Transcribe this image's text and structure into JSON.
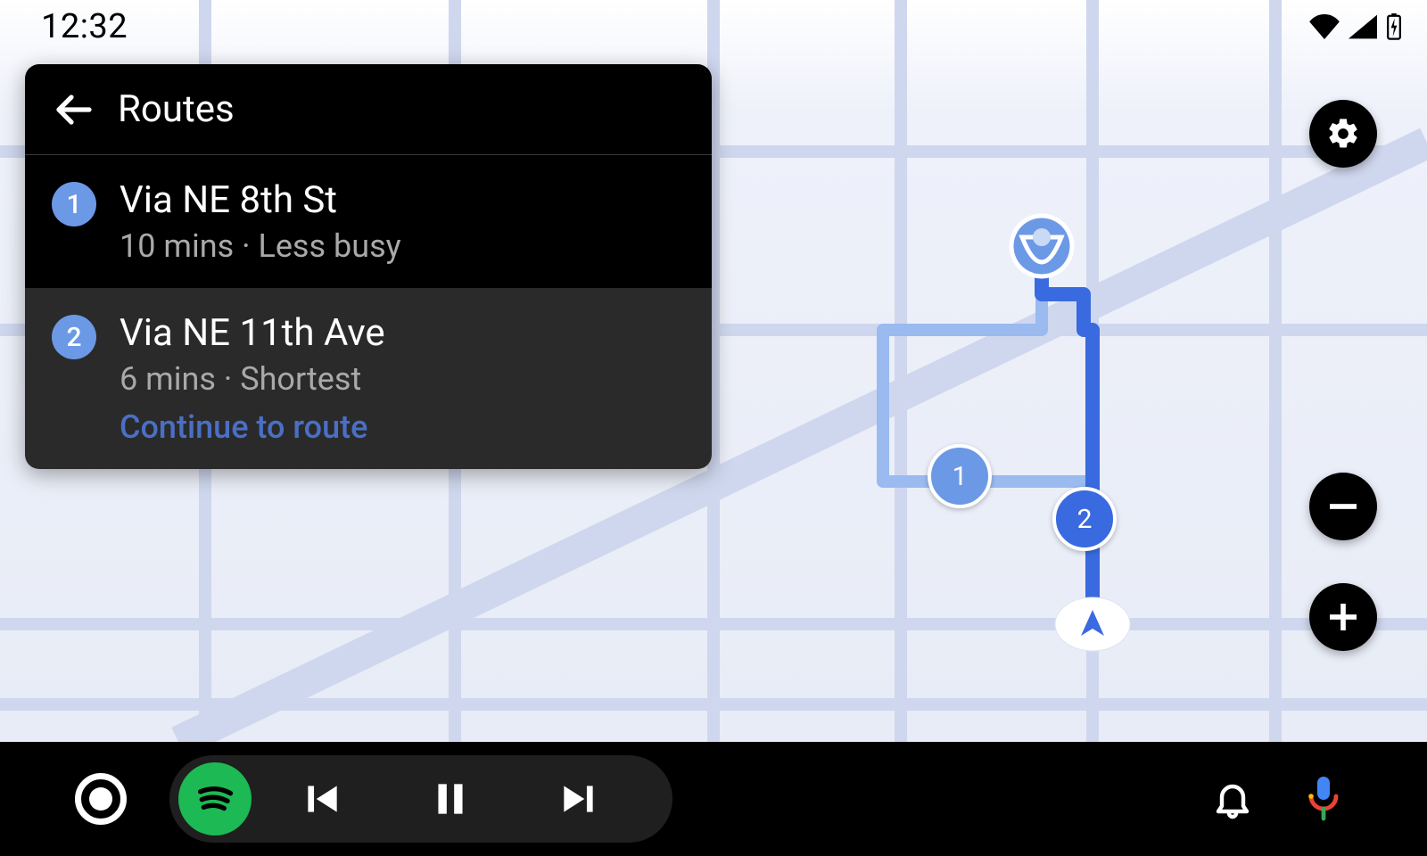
{
  "status_bar": {
    "time": "12:32"
  },
  "card": {
    "title": "Routes",
    "routes": [
      {
        "num": "1",
        "title": "Via NE 8th St",
        "sub": "10 mins · Less busy",
        "cta": ""
      },
      {
        "num": "2",
        "title": "Via NE 11th Ave",
        "sub": "6 mins · Shortest",
        "cta": "Continue to route"
      }
    ]
  },
  "map": {
    "marker1": "1",
    "marker2": "2"
  },
  "colors": {
    "route1": "#6c99e6",
    "route2": "#3a6adf",
    "accent_link": "#4a6fc5",
    "spotify": "#1db954"
  }
}
